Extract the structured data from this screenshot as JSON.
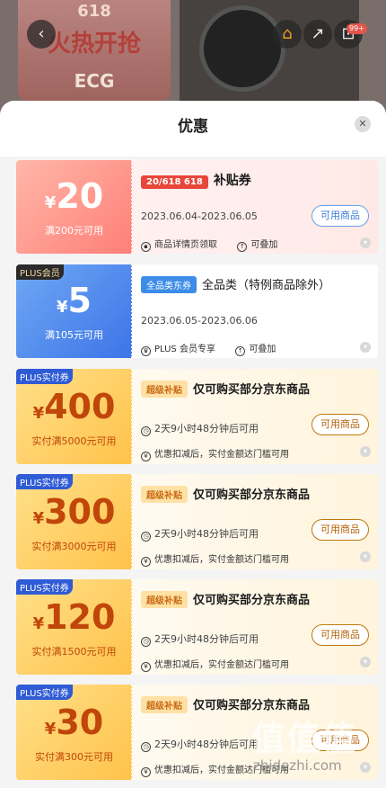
{
  "background": {
    "promo_top": "618",
    "promo_main": "火热开抢",
    "promo_bottom": "ECG",
    "cart_badge": "99+"
  },
  "sheet": {
    "title": "优惠"
  },
  "coupons": [
    {
      "symbol": "¥",
      "amount": "20",
      "condition": "满200元可用",
      "corner_tag": "",
      "title_pill": "20/618 618",
      "title": "补贴券",
      "date": "2023.06.04-2023.06.05",
      "button": "可用商品",
      "info1": "商品详情页领取",
      "info2": "可叠加"
    },
    {
      "symbol": "¥",
      "amount": "5",
      "condition": "满105元可用",
      "corner_tag": "PLUS会员",
      "title_pill": "全品类东券",
      "title": "全品类（特例商品除外）",
      "date": "2023.06.05-2023.06.06",
      "button": "",
      "info1": "PLUS 会员专享",
      "info2": "可叠加"
    },
    {
      "symbol": "¥",
      "amount": "400",
      "condition": "实付满5000元可用",
      "corner_tag": "PLUS实付券",
      "title_pill": "超级补贴",
      "title": "仅可购买部分京东商品",
      "date": "2天9小时48分钟后可用",
      "button": "可用商品",
      "info1": "优惠扣减后，实付金额达门槛可用"
    },
    {
      "symbol": "¥",
      "amount": "300",
      "condition": "实付满3000元可用",
      "corner_tag": "PLUS实付券",
      "title_pill": "超级补贴",
      "title": "仅可购买部分京东商品",
      "date": "2天9小时48分钟后可用",
      "button": "可用商品",
      "info1": "优惠扣减后，实付金额达门槛可用"
    },
    {
      "symbol": "¥",
      "amount": "120",
      "condition": "实付满1500元可用",
      "corner_tag": "PLUS实付券",
      "title_pill": "超级补贴",
      "title": "仅可购买部分京东商品",
      "date": "2天9小时48分钟后可用",
      "button": "可用商品",
      "info1": "优惠扣减后，实付金额达门槛可用"
    },
    {
      "symbol": "¥",
      "amount": "30",
      "condition": "实付满300元可用",
      "corner_tag": "PLUS实付券",
      "title_pill": "超级补贴",
      "title": "仅可购买部分京东商品",
      "date": "2天9小时48分钟后可用",
      "button": "可用商品",
      "info1": "优惠扣减后，实付金额达门槛可用"
    }
  ],
  "watermark": {
    "main": "值值值",
    "sub": "zhidezhi.com"
  },
  "colors": {
    "accent_red": "#e8463a",
    "plus_gold": "#c0770e",
    "blue_pill": "#3c8ce8"
  }
}
